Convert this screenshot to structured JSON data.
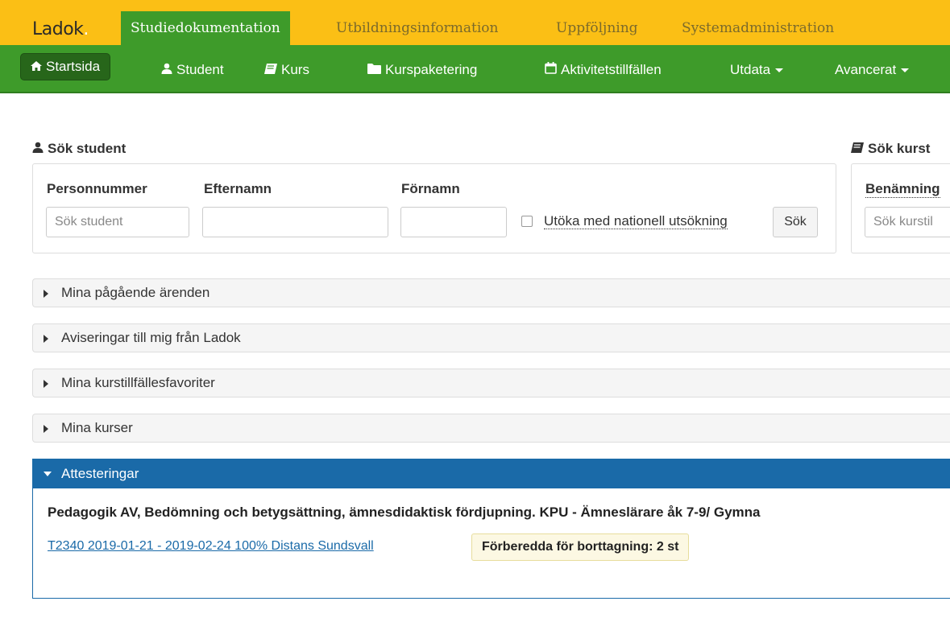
{
  "header": {
    "logo": "Ladok",
    "logo_dot": ".",
    "modules": [
      {
        "label": "Studiedokumentation",
        "active": true
      },
      {
        "label": "Utbildningsinformation",
        "active": false
      },
      {
        "label": "Uppföljning",
        "active": false
      },
      {
        "label": "Systemadministration",
        "active": false
      }
    ]
  },
  "nav": {
    "items": [
      {
        "label": "Startsida",
        "icon": "home-icon",
        "active": true
      },
      {
        "label": "Student",
        "icon": "user-icon"
      },
      {
        "label": "Kurs",
        "icon": "book-icon"
      },
      {
        "label": "Kurspaketering",
        "icon": "folder-icon"
      },
      {
        "label": "Aktivitetstillfällen",
        "icon": "calendar-icon"
      },
      {
        "label": "Utdata",
        "dropdown": true
      },
      {
        "label": "Avancerat",
        "dropdown": true
      }
    ]
  },
  "student_search": {
    "title": "Sök student",
    "personnummer_label": "Personnummer",
    "personnummer_placeholder": "Sök student",
    "efternamn_label": "Efternamn",
    "fornamn_label": "Förnamn",
    "national_search_label": "Utöka med nationell utsökning",
    "national_search_checked": false,
    "search_button": "Sök"
  },
  "course_search": {
    "title": "Sök kurst",
    "benamning_label": "Benämning",
    "placeholder": "Sök kurstil"
  },
  "accordions": [
    {
      "title": "Mina pågående ärenden"
    },
    {
      "title": "Aviseringar till mig från Ladok"
    },
    {
      "title": "Mina kurstillfällesfavoriter"
    },
    {
      "title": "Mina kurser"
    }
  ],
  "attesteringar": {
    "title": "Attesteringar",
    "course_title": "Pedagogik AV, Bedömning och betygsättning, ämnesdidaktisk fördjupning. KPU - Ämneslärare åk 7-9/ Gymna",
    "course_link": "T2340 2019-01-21 - 2019-02-24 100% Distans Sundsvall",
    "badge": "Förberedda för borttagning: 2 st"
  },
  "colors": {
    "top_yellow": "#fbbf15",
    "nav_green": "#3e9b2a",
    "accent_blue": "#1a6aa8"
  }
}
